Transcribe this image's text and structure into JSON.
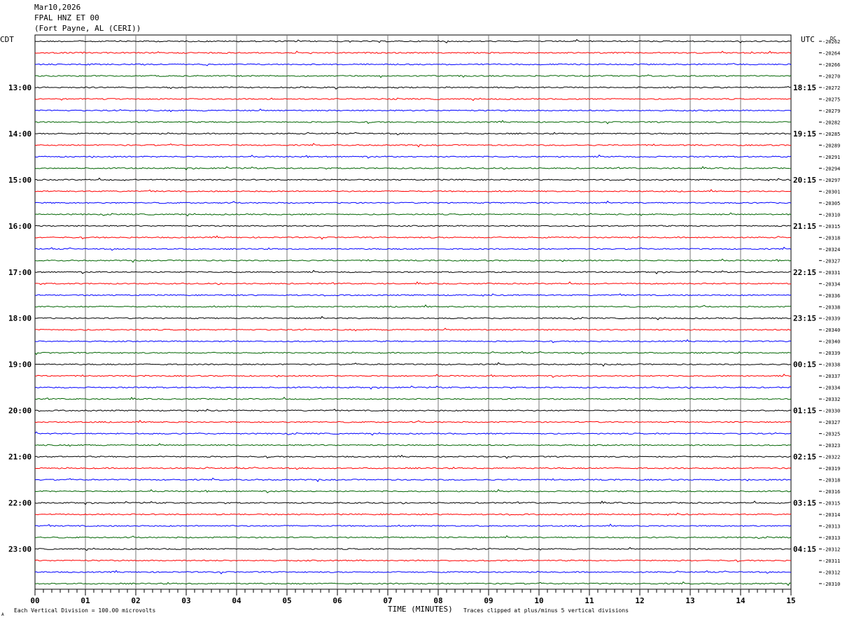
{
  "header": {
    "date": "Mar10,2026",
    "station": "FPAL HNZ ET 00",
    "location": "(Fort Payne, AL (CERI))"
  },
  "footer": {
    "scale_note": "Each Vertical Division =  100.00 microvolts",
    "clip_note": "Traces clipped at plus/minus 5 vertical divisions",
    "corner_mark": "A"
  },
  "chart_data": {
    "type": "line",
    "title": "",
    "xlabel": "TIME (MINUTES)",
    "ylabel_left": "CDT",
    "ylabel_right": "UTC",
    "dc_label": "DC",
    "xlim": [
      0,
      15
    ],
    "x_ticks": [
      "00",
      "01",
      "02",
      "03",
      "04",
      "05",
      "06",
      "07",
      "08",
      "09",
      "10",
      "11",
      "12",
      "13",
      "14",
      "15"
    ],
    "trace_colors": [
      "#000000",
      "#ff0000",
      "#0000ff",
      "#006400"
    ],
    "grid": true,
    "left_hour_labels": [
      "13:00",
      "14:00",
      "15:00",
      "16:00",
      "17:00",
      "18:00",
      "19:00",
      "20:00",
      "21:00",
      "22:00",
      "23:00"
    ],
    "right_hour_labels": [
      "18:15",
      "19:15",
      "20:15",
      "21:15",
      "22:15",
      "23:15",
      "00:15",
      "01:15",
      "02:15",
      "03:15",
      "04:15"
    ],
    "dc_offsets": [
      "-20262",
      "-20264",
      "-20266",
      "-20270",
      "-20272",
      "-20275",
      "-20279",
      "-20282",
      "-20285",
      "-20289",
      "-20291",
      "-20294",
      "-20297",
      "-20301",
      "-20305",
      "-20310",
      "-20315",
      "-20318",
      "-20324",
      "-20327",
      "-20331",
      "-20334",
      "-20336",
      "-20338",
      "-20339",
      "-20340",
      "-20340",
      "-20339",
      "-20338",
      "-20337",
      "-20334",
      "-20332",
      "-20330",
      "-20327",
      "-20325",
      "-20323",
      "-20322",
      "-20319",
      "-20318",
      "-20316",
      "-20315",
      "-20314",
      "-20313",
      "-20313",
      "-20312",
      "-20311",
      "-20312",
      "-20310"
    ]
  }
}
